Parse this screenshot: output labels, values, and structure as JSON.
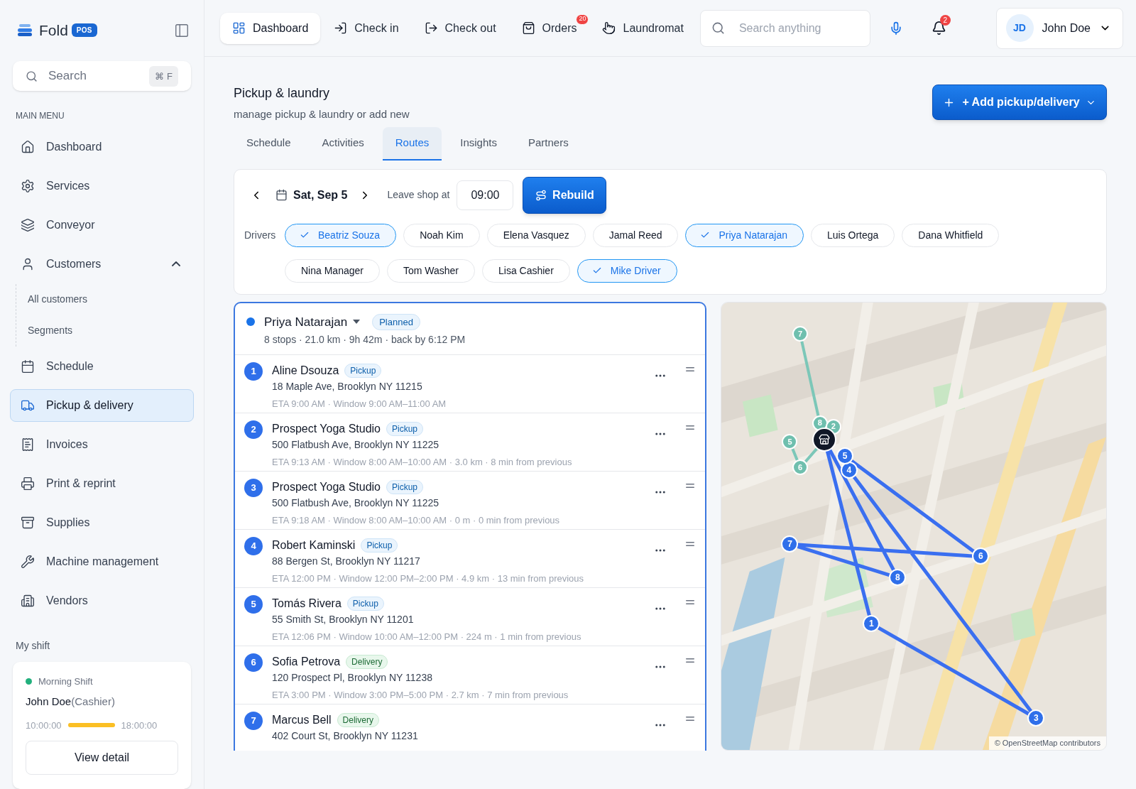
{
  "sidebar": {
    "brand": "Fold",
    "brand_badge": "POS",
    "search": {
      "placeholder": "Search",
      "shortcut": "⌘ F"
    },
    "section_label": "MAIN MENU",
    "items": [
      {
        "label": "Dashboard",
        "selected": false
      },
      {
        "label": "Services",
        "selected": false
      },
      {
        "label": "Conveyor",
        "selected": false
      },
      {
        "label": "Customers",
        "selected": false,
        "expanded": true,
        "children": [
          {
            "label": "All customers"
          },
          {
            "label": "Segments"
          }
        ]
      },
      {
        "label": "Schedule",
        "selected": false
      },
      {
        "label": "Pickup & delivery",
        "selected": true
      },
      {
        "label": "Invoices",
        "selected": false
      },
      {
        "label": "Print & reprint",
        "selected": false
      },
      {
        "label": "Supplies",
        "selected": false
      },
      {
        "label": "Machine management",
        "selected": false
      },
      {
        "label": "Vendors",
        "selected": false
      }
    ],
    "shift_label": "My shift",
    "shift": {
      "name": "Morning Shift",
      "color": "#22b07d",
      "person": "John Doe",
      "role": "(Cashier)",
      "start": "10:00:00",
      "end": "18:00:00",
      "level": 1,
      "button": "View detail"
    }
  },
  "topbar": {
    "nav": [
      {
        "label": "Dashboard",
        "selected": true
      },
      {
        "label": "Check in",
        "selected": false
      },
      {
        "label": "Check out",
        "selected": false
      },
      {
        "label": "Orders",
        "selected": false,
        "badge": "20"
      },
      {
        "label": "Laundromat",
        "selected": false
      }
    ],
    "search": {
      "placeholder": "Search anything"
    },
    "notifications": "2",
    "user": {
      "initials": "JD",
      "name": "John Doe"
    }
  },
  "page": {
    "title": "Pickup & laundry",
    "subtitle": "manage pickup & laundry or add new",
    "add_button": "+ Add pickup/delivery",
    "tabs": [
      {
        "label": "Schedule",
        "selected": false
      },
      {
        "label": "Activities",
        "selected": false
      },
      {
        "label": "Routes",
        "selected": true
      },
      {
        "label": "Insights",
        "selected": false
      },
      {
        "label": "Partners",
        "selected": false
      }
    ]
  },
  "controls": {
    "date": "Sat, Sep 5",
    "leave_label": "Leave shop at",
    "leave_time": "09:00",
    "rebuild": "Rebuild",
    "drivers_label": "Drivers",
    "drivers": [
      {
        "name": "Beatriz Souza",
        "selected": true
      },
      {
        "name": "Noah Kim",
        "selected": false
      },
      {
        "name": "Elena Vasquez",
        "selected": false
      },
      {
        "name": "Jamal Reed",
        "selected": false
      },
      {
        "name": "Priya Natarajan",
        "selected": true
      },
      {
        "name": "Luis Ortega",
        "selected": false
      },
      {
        "name": "Dana Whitfield",
        "selected": false
      },
      {
        "name": "Nina Manager",
        "selected": false
      },
      {
        "name": "Tom Washer",
        "selected": false
      },
      {
        "name": "Lisa Cashier",
        "selected": false
      },
      {
        "name": "Mike Driver",
        "selected": true
      }
    ]
  },
  "route": {
    "driver": "Priya Natarajan",
    "color": "#1a73e8",
    "status": "Planned",
    "summary": "8 stops · 21.0 km · 9h 42m · back by 6:12 PM",
    "stops": [
      {
        "number": "1",
        "name": "Aline Dsouza",
        "kind": "pickup",
        "tag": "Pickup",
        "address": "18 Maple Ave, Brooklyn NY 11215",
        "details": "ETA 9:00 AM · Window 9:00 AM–11:00 AM"
      },
      {
        "number": "2",
        "name": "Prospect Yoga Studio",
        "kind": "pickup",
        "tag": "Pickup",
        "address": "500 Flatbush Ave, Brooklyn NY 11225",
        "details": "ETA 9:13 AM · Window 8:00 AM–10:00 AM · 3.0 km · 8 min from previous"
      },
      {
        "number": "3",
        "name": "Prospect Yoga Studio",
        "kind": "pickup",
        "tag": "Pickup",
        "address": "500 Flatbush Ave, Brooklyn NY 11225",
        "details": "ETA 9:18 AM · Window 8:00 AM–10:00 AM · 0 m · 0 min from previous"
      },
      {
        "number": "4",
        "name": "Robert Kaminski",
        "kind": "pickup",
        "tag": "Pickup",
        "address": "88 Bergen St, Brooklyn NY 11217",
        "details": "ETA 12:00 PM · Window 12:00 PM–2:00 PM · 4.9 km · 13 min from previous"
      },
      {
        "number": "5",
        "name": "Tomás Rivera",
        "kind": "pickup",
        "tag": "Pickup",
        "address": "55 Smith St, Brooklyn NY 11201",
        "details": "ETA 12:06 PM · Window 10:00 AM–12:00 PM · 224 m · 1 min from previous"
      },
      {
        "number": "6",
        "name": "Sofia Petrova",
        "kind": "delivery",
        "tag": "Delivery",
        "address": "120 Prospect Pl, Brooklyn NY 11238",
        "details": "ETA 3:00 PM · Window 3:00 PM–5:00 PM · 2.7 km · 7 min from previous"
      },
      {
        "number": "7",
        "name": "Marcus Bell",
        "kind": "delivery",
        "tag": "Delivery",
        "address": "402 Court St, Brooklyn NY 11231"
      }
    ]
  },
  "map": {
    "kind": "picture",
    "route_markers": [
      "1",
      "3",
      "4",
      "5",
      "6",
      "7",
      "8"
    ],
    "other_markers": [
      "7",
      "8",
      "2",
      "5",
      "6"
    ],
    "attribution": "© OpenStreetMap contributors"
  }
}
